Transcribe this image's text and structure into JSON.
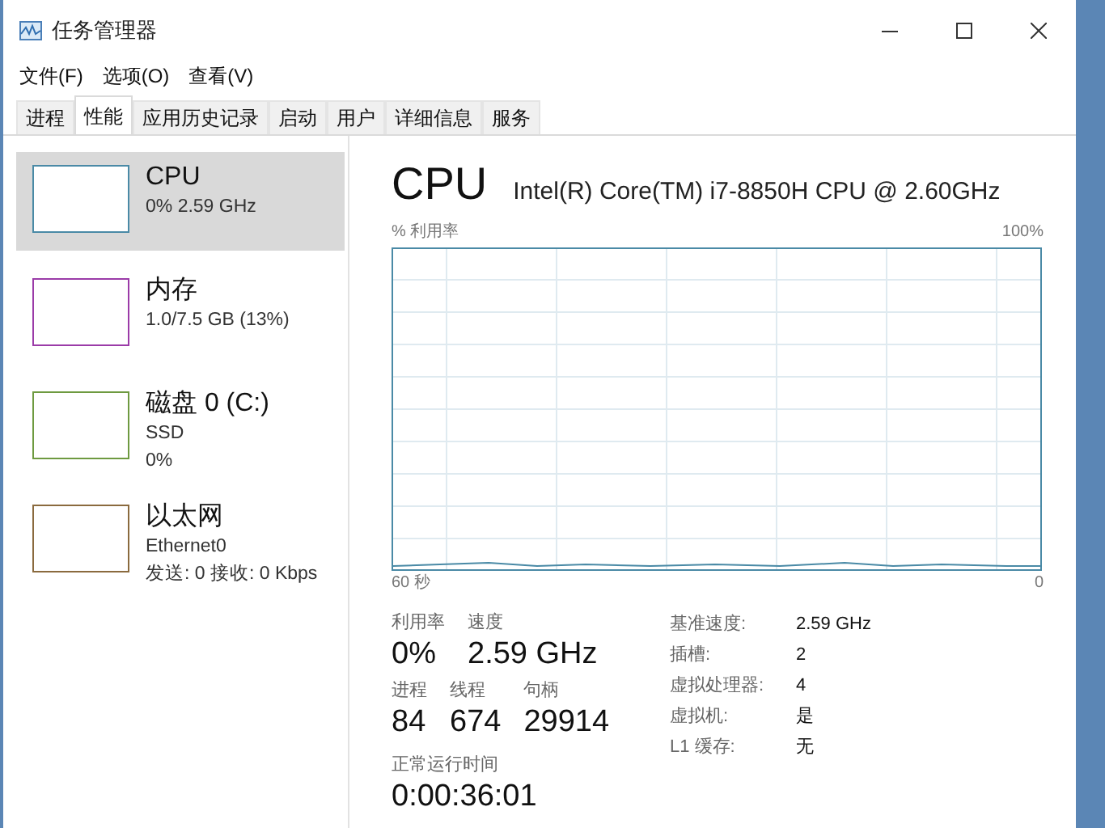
{
  "window": {
    "title": "任务管理器"
  },
  "menu": [
    "文件(F)",
    "选项(O)",
    "查看(V)"
  ],
  "tabs": [
    {
      "label": "进程",
      "selected": false
    },
    {
      "label": "性能",
      "selected": true
    },
    {
      "label": "应用历史记录",
      "selected": false
    },
    {
      "label": "启动",
      "selected": false
    },
    {
      "label": "用户",
      "selected": false
    },
    {
      "label": "详细信息",
      "selected": false
    },
    {
      "label": "服务",
      "selected": false
    }
  ],
  "sidebar": {
    "items": [
      {
        "title": "CPU",
        "lines": [
          "0% 2.59 GHz"
        ],
        "color": "#4a8aa6",
        "selected": true
      },
      {
        "title": "内存",
        "lines": [
          "1.0/7.5 GB (13%)"
        ],
        "color": "#9b3ba8",
        "selected": false
      },
      {
        "title": "磁盘 0 (C:)",
        "lines": [
          "SSD",
          "0%"
        ],
        "color": "#6e9a40",
        "selected": false
      },
      {
        "title": "以太网",
        "lines": [
          "Ethernet0",
          "发送: 0 接收: 0 Kbps"
        ],
        "color": "#8a6a3e",
        "selected": false
      }
    ]
  },
  "detail": {
    "title": "CPU",
    "model": "Intel(R) Core(TM) i7-8850H CPU @ 2.60GHz",
    "graph": {
      "ylabel": "% 利用率",
      "ymax": "100%",
      "xstart": "60 秒",
      "xend": "0"
    },
    "stats": [
      [
        {
          "label": "利用率",
          "value": "0%"
        },
        {
          "label": "速度",
          "value": "2.59 GHz"
        }
      ],
      [
        {
          "label": "进程",
          "value": "84"
        },
        {
          "label": "线程",
          "value": "674"
        },
        {
          "label": "句柄",
          "value": "29914"
        }
      ]
    ],
    "uptime": {
      "label": "正常运行时间",
      "value": "0:00:36:01"
    },
    "specs": [
      {
        "key": "基准速度:",
        "value": "2.59 GHz"
      },
      {
        "key": "插槽:",
        "value": "2"
      },
      {
        "key": "虚拟处理器:",
        "value": "4"
      },
      {
        "key": "虚拟机:",
        "value": "是"
      },
      {
        "key": "L1 缓存:",
        "value": "无"
      }
    ]
  }
}
